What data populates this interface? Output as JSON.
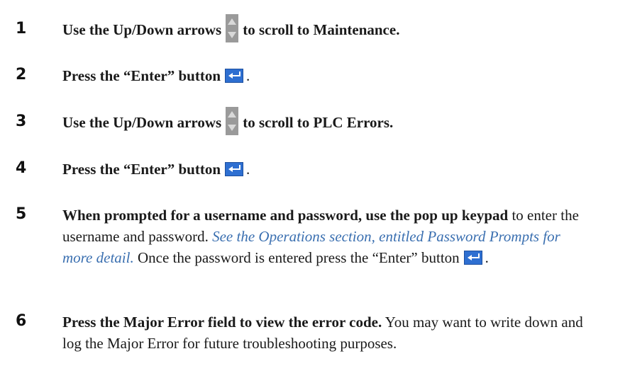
{
  "steps": [
    {
      "number": "1",
      "bold_before": "Use the Up/Down arrows",
      "icon": "up-down-arrows-icon",
      "bold_after": "to scroll to Maintenance."
    },
    {
      "number": "2",
      "bold_before": "Press the “Enter” button",
      "icon": "enter-icon",
      "after": "."
    },
    {
      "number": "3",
      "bold_before": "Use the Up/Down arrows",
      "icon": "up-down-arrows-icon",
      "bold_after": "to scroll to PLC Errors."
    },
    {
      "number": "4",
      "bold_before": "Press the “Enter” button",
      "icon": "enter-icon",
      "after": "."
    },
    {
      "number": "5",
      "bold_text": "When prompted for a username and password, use the pop up keypad",
      "text_1": "to enter the username and password.",
      "link_text": "See the Operations section, entitled Password Prompts for more detail.",
      "text_2": "Once the password is entered press the “Enter” button",
      "icon": "enter-icon",
      "after": "."
    },
    {
      "number": "6",
      "bold_text": "Press the Major Error field to view the error code.",
      "text": "You may want to write down and log the Major Error for future troubleshooting purposes."
    }
  ],
  "colors": {
    "link": "#3a6fb0",
    "enter_button": "#2e6fd1",
    "arrows_button": "#9a9a9a"
  }
}
